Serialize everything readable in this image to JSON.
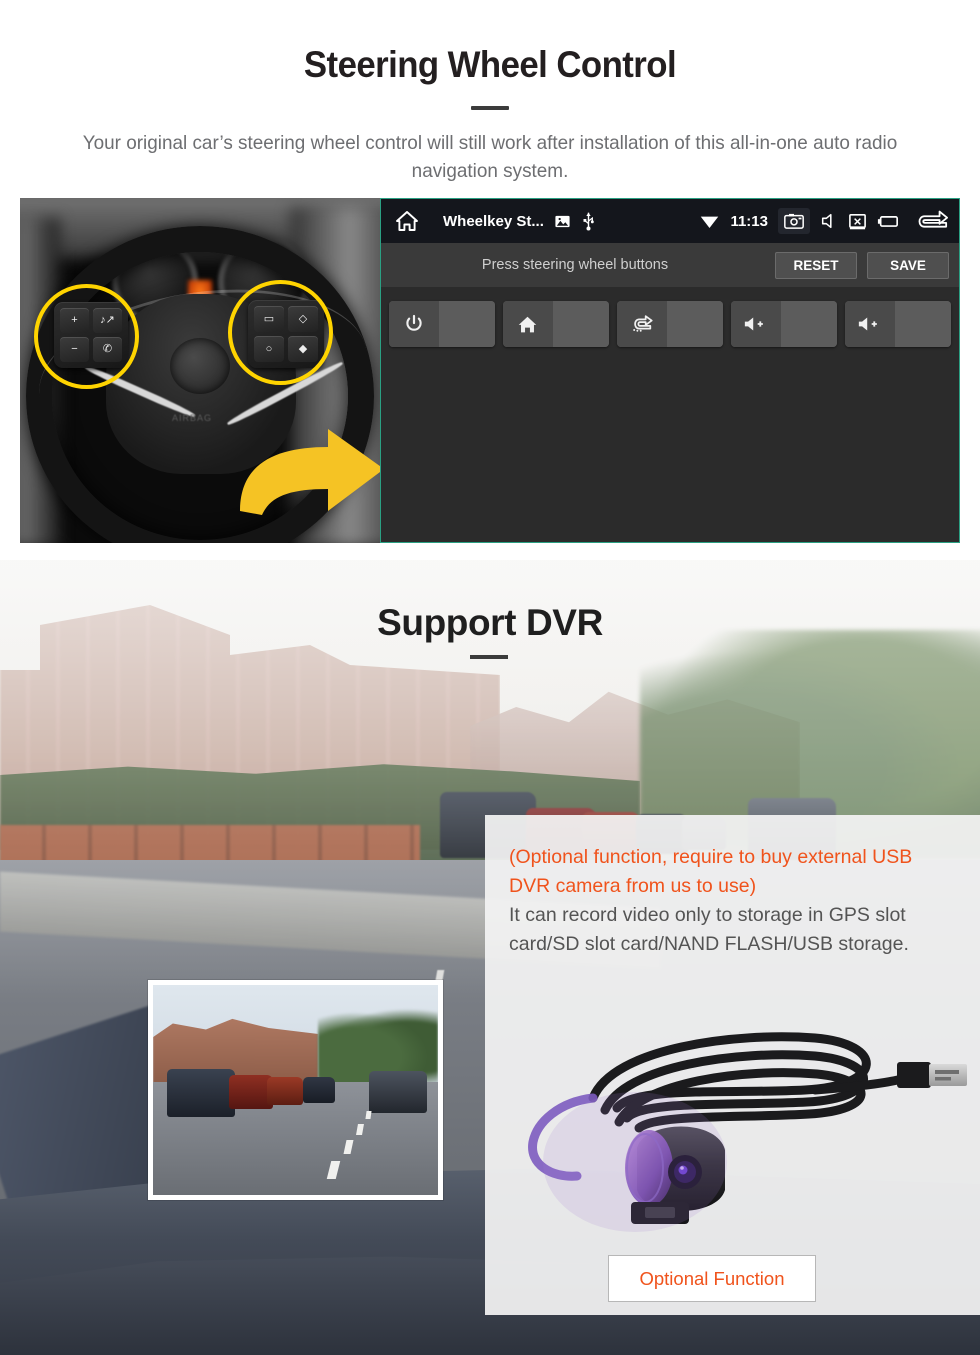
{
  "steering_section": {
    "title": "Steering Wheel Control",
    "subtitle": "Your original car’s steering wheel control will still work after installation of this all-in-one auto radio navigation system.",
    "wheel_photo": {
      "alt": "car-steering-wheel-with-highlighted-control-buttons",
      "left_pad_keys": [
        "+",
        "−",
        "♪↗",
        "✆"
      ],
      "right_pad_keys": [
        "▭",
        "◇",
        "○",
        "◆"
      ],
      "airbag_label": "AIRBAG"
    },
    "head_unit": {
      "statusbar": {
        "app_title": "Wheelkey St...",
        "time": "11:13",
        "icons_left": [
          "home-icon",
          "gallery-icon",
          "usb-icon"
        ],
        "icons_right": [
          "wifi-icon",
          "screenshot-icon",
          "volume-icon",
          "close-screen-icon",
          "recents-icon",
          "back-icon"
        ]
      },
      "actionbar": {
        "hint": "Press steering wheel buttons",
        "reset_label": "RESET",
        "save_label": "SAVE"
      },
      "keys": [
        {
          "icon": "power-icon",
          "value": ""
        },
        {
          "icon": "home-icon",
          "value": ""
        },
        {
          "icon": "back-icon",
          "value": ""
        },
        {
          "icon": "volume-up-icon",
          "value": ""
        },
        {
          "icon": "volume-up-icon",
          "value": ""
        }
      ],
      "border_color": "#2aa083"
    }
  },
  "dvr_section": {
    "title": "Support DVR",
    "panel": {
      "highlight_text": "(Optional function, require to buy external USB DVR camera from us to use)",
      "body_text": "It can record video only to storage in GPS slot card/SD slot card/NAND FLASH/USB storage.",
      "highlight_color": "#f0531c",
      "body_color": "#545454",
      "product_alt": "usb-dvr-camera-with-cable",
      "button_label": "Optional Function"
    },
    "inset_alt": "dashcam-recorded-street-view"
  }
}
